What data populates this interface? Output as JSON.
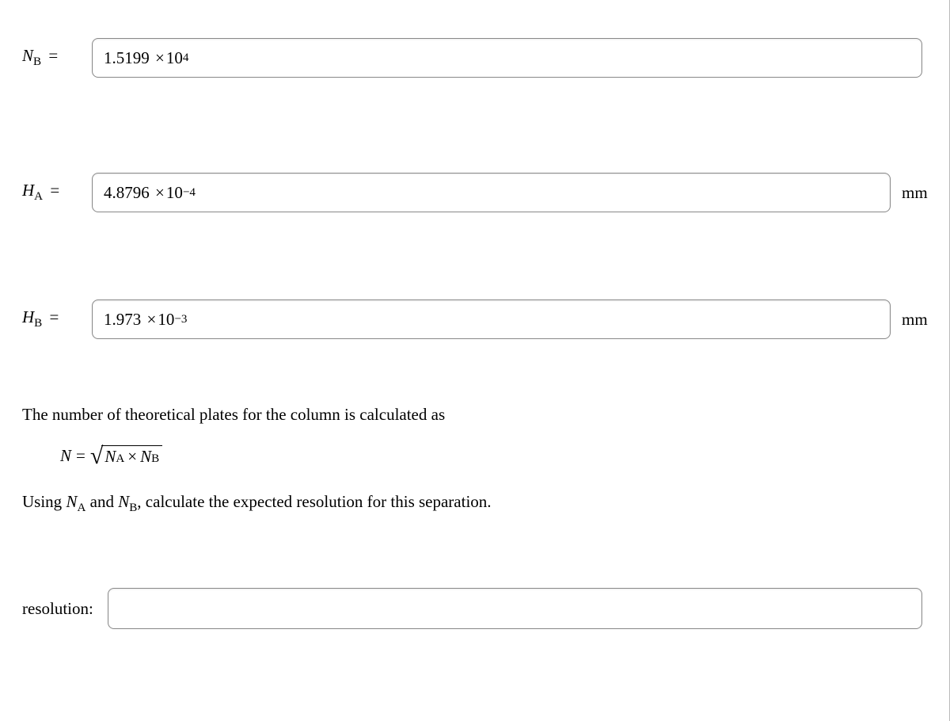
{
  "fields": {
    "NB": {
      "label_base": "N",
      "label_sub": "B",
      "value_coeff": "1.5199",
      "value_exp": "4",
      "unit": ""
    },
    "HA": {
      "label_base": "H",
      "label_sub": "A",
      "value_coeff": "4.8796",
      "value_exp": "−4",
      "unit": "mm"
    },
    "HB": {
      "label_base": "H",
      "label_sub": "B",
      "value_coeff": "1.973",
      "value_exp": "−3",
      "unit": "mm"
    },
    "resolution": {
      "label": "resolution:",
      "value": ""
    }
  },
  "text": {
    "para1": "The number of theoretical plates for the column is calculated as",
    "para2_pre": "Using ",
    "para2_mid": " and ",
    "para2_post": ", calculate the expected resolution for this separation."
  },
  "formula": {
    "lhs_base": "N",
    "rhs_a_base": "N",
    "rhs_a_sub": "A",
    "rhs_b_base": "N",
    "rhs_b_sub": "B"
  },
  "symbols": {
    "eq": "=",
    "times": "×",
    "ten": "10"
  }
}
